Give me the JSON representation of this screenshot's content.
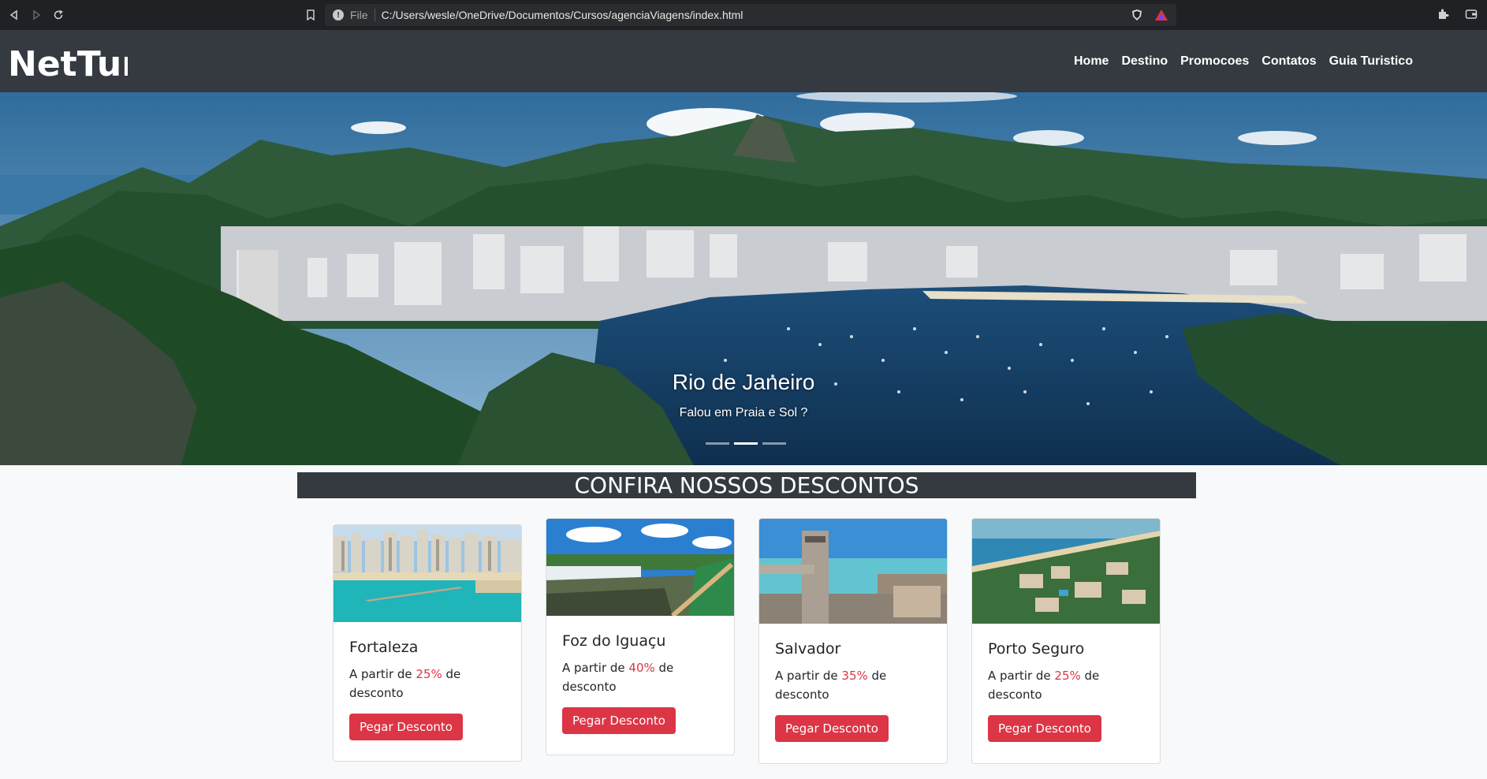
{
  "browser": {
    "scheme": "File",
    "url": "C:/Users/wesle/OneDrive/Documentos/Cursos/agenciaViagens/index.html"
  },
  "site": {
    "logo_text": "NetTur",
    "nav": [
      "Home",
      "Destino",
      "Promocoes",
      "Contatos",
      "Guia Turistico"
    ]
  },
  "hero": {
    "title": "Rio de Janeiro",
    "subtitle": "Falou em Praia e Sol ?",
    "slides_count": 3,
    "active_slide": 2
  },
  "section": {
    "title": "CONFIRA NOSSOS DESCONTOS"
  },
  "cards": [
    {
      "name": "Fortaleza",
      "prefix": "A partir de ",
      "discount": "25%",
      "suffix": " de",
      "line2": "desconto",
      "button": "Pegar Desconto"
    },
    {
      "name": "Foz do Iguaçu",
      "prefix": "A partir de ",
      "discount": "40%",
      "suffix": " de",
      "line2": "desconto",
      "button": "Pegar Desconto"
    },
    {
      "name": "Salvador",
      "prefix": "A partir de ",
      "discount": "35%",
      "suffix": " de",
      "line2": "desconto",
      "button": "Pegar Desconto"
    },
    {
      "name": "Porto Seguro",
      "prefix": "A partir de ",
      "discount": "25%",
      "suffix": " de",
      "line2": "desconto",
      "button": "Pegar Desconto"
    }
  ],
  "colors": {
    "navbar": "#343a40",
    "button": "#dc3545",
    "accent_text": "#dc3545"
  }
}
